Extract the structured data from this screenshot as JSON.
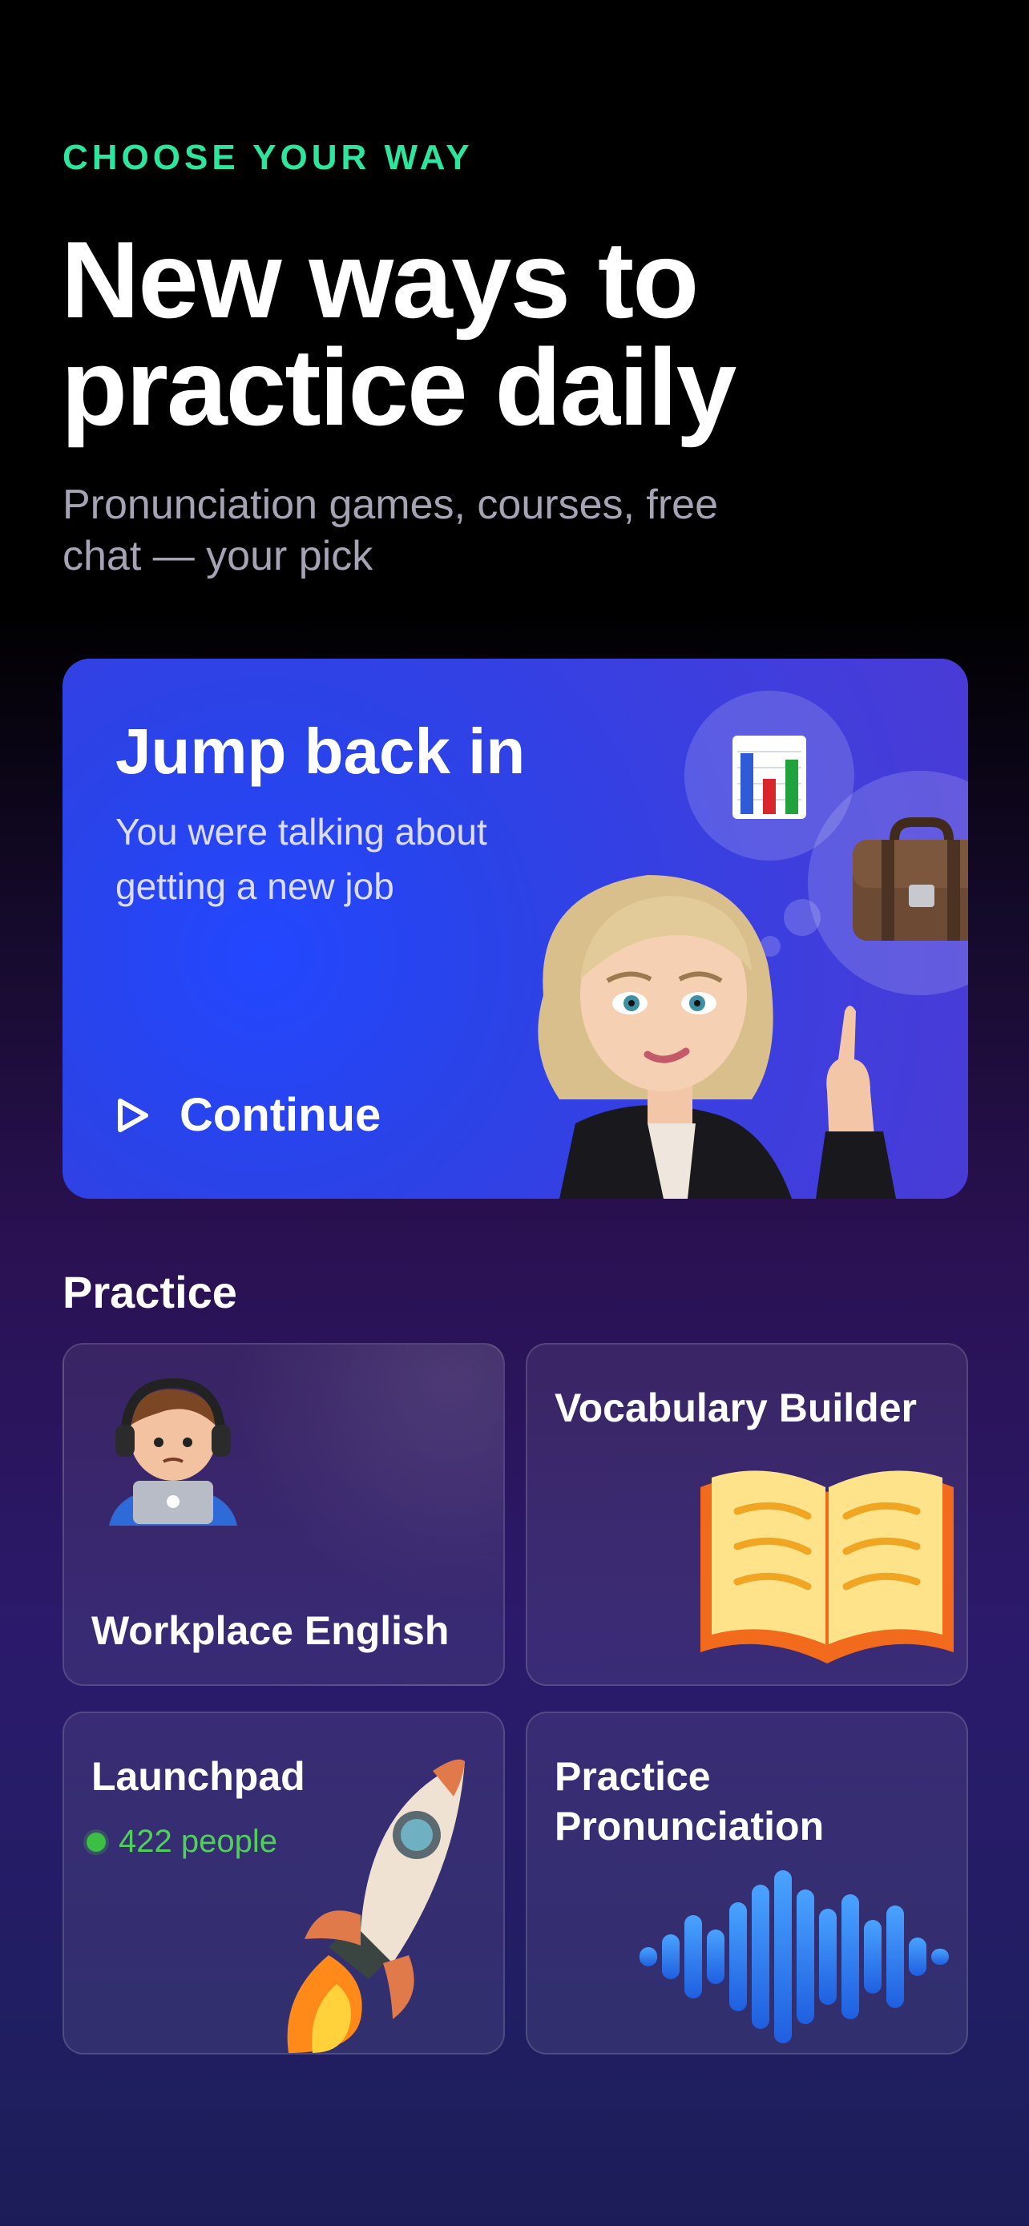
{
  "header": {
    "kicker": "CHOOSE YOUR WAY",
    "title_line1": "New ways to",
    "title_line2": "practice daily",
    "subtitle_line1": "Pronunciation games, courses, free",
    "subtitle_line2": "chat — your pick"
  },
  "hero": {
    "title": "Jump back in",
    "subtitle_line1": "You were talking about",
    "subtitle_line2": "getting a new job",
    "button_label": "Continue"
  },
  "practice": {
    "section_title": "Practice",
    "cards": [
      {
        "label": "Workplace English",
        "icon": "developer-with-headphones-icon"
      },
      {
        "label": "Vocabulary Builder",
        "icon": "open-book-icon"
      },
      {
        "label": "Launchpad",
        "online_count": "422 people",
        "icon": "rocket-icon"
      },
      {
        "label_line1": "Practice",
        "label_line2": "Pronunciation",
        "icon": "sound-wave-icon"
      }
    ]
  },
  "colors": {
    "accent": "#2ee59d",
    "online": "#3bbf45",
    "hero": "#2a43e8"
  }
}
